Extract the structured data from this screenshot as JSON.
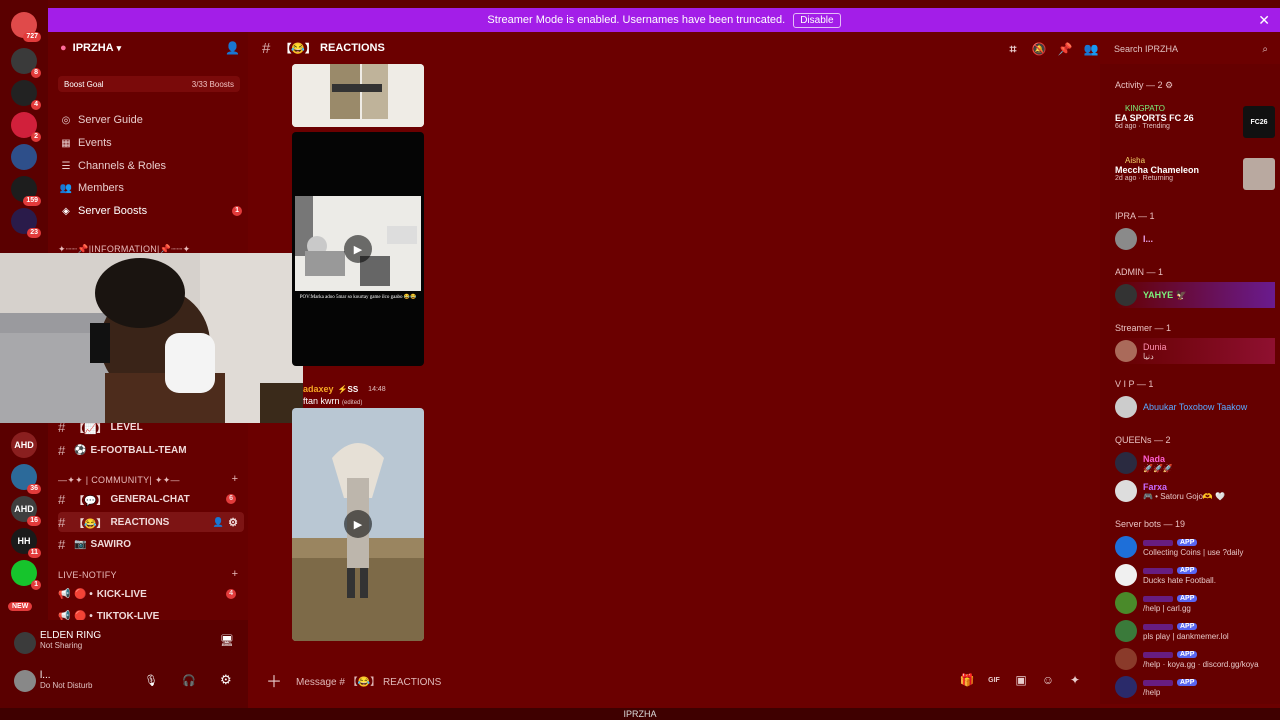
{
  "banner": {
    "text": "Streamer Mode is enabled. Usernames have been truncated.",
    "disable_label": "Disable"
  },
  "server": {
    "name": "IPRZHA",
    "boost_label": "Boost Goal",
    "boost_count": "3/33 Boosts"
  },
  "nav": [
    {
      "icon": "compass-icon",
      "label": "Server Guide"
    },
    {
      "icon": "calendar-icon",
      "label": "Events"
    },
    {
      "icon": "list-icon",
      "label": "Channels & Roles"
    },
    {
      "icon": "members-icon",
      "label": "Members"
    },
    {
      "icon": "boost-icon",
      "label": "Server Boosts",
      "badge": "1"
    }
  ],
  "categories": {
    "information": "✦┈┈📌|INFORMATION|📌┈┈✦",
    "community": "—✦✦ | COMMUNITY| ✦✦—",
    "live": "LIVE-NOTIFY"
  },
  "channels": [
    {
      "label": "LEVEL",
      "prefix": "【📈】"
    },
    {
      "label": "E-FOOTBALL-TEAM",
      "prefix": "⚽"
    },
    {
      "label": "GENERAL-CHAT",
      "prefix": "【💬】",
      "badge": "6"
    },
    {
      "label": "REACTIONS",
      "prefix": "【😂】"
    },
    {
      "label": "SAWIRO",
      "prefix": "📷"
    },
    {
      "label": "KICK-LIVE",
      "prefix": "🔴 •",
      "badge": "4"
    },
    {
      "label": "TIKTOK-LIVE",
      "prefix": "🔴 •"
    }
  ],
  "activity_card": {
    "title": "ELDEN RING",
    "subtitle": "Not Sharing"
  },
  "user": {
    "name": "l...",
    "status": "Do Not Disturb"
  },
  "channel": {
    "prefix": "【😂】",
    "name": "REACTIONS"
  },
  "search": {
    "placeholder": "Search IPRZHA"
  },
  "message": {
    "author": "adaxey",
    "tag": "⚡SS",
    "time": "14:48",
    "text": "ftan kwrn",
    "edited": "(edited)",
    "video_caption": "POV:Marka adoo 5mar so kourtay game ilco gaabo 😂😂"
  },
  "composer": {
    "placeholder": "Message # 【😂】 REACTIONS"
  },
  "activity": {
    "title": "Activity — 2",
    "items": [
      {
        "user": "KINGPATO",
        "game": "EA SPORTS FC 26",
        "meta": "6d ago",
        "tag": "Trending",
        "thumb": "FC26"
      },
      {
        "user": "Aisha",
        "game": "Meccha Chameleon",
        "meta": "2d ago",
        "tag": "Returning"
      }
    ]
  },
  "member_sections": [
    {
      "title": "IPRA — 1",
      "members": [
        {
          "name": "I...",
          "color": "#e8a0e8"
        }
      ]
    },
    {
      "title": "ADMIN — 1",
      "members": [
        {
          "name": "YAHYE 🦅",
          "color": "#7cf07c"
        }
      ]
    },
    {
      "title": "Streamer — 1",
      "members": [
        {
          "name": "Dunia",
          "sub": "دنيا",
          "color": "#ff8fb0"
        }
      ]
    },
    {
      "title": "V I P — 1",
      "members": [
        {
          "name": "Abuukar Toxobow Taakow",
          "color": "#59a8ff"
        }
      ]
    },
    {
      "title": "QUEENs — 2",
      "members": [
        {
          "name": "Nada",
          "sub": "🚀🚀🚀",
          "color": "#ff5fd2"
        },
        {
          "name": "Farxa",
          "sub": "🎮 • Satoru Gojo🫶 🤍",
          "color": "#c86bff"
        }
      ]
    }
  ],
  "bots": {
    "title": "Server bots — 19",
    "app_label": "APP",
    "items": [
      {
        "sub": "Collecting Coins | use ?daily"
      },
      {
        "sub": "Ducks hate Football."
      },
      {
        "sub": "/help | carl.gg"
      },
      {
        "sub": "pls play | dankmemer.lol"
      },
      {
        "sub": "/help · koya.gg · discord.gg/koya"
      },
      {
        "sub": "/help"
      }
    ]
  },
  "window": {
    "title": "IPRZHA"
  },
  "rail": [
    {
      "badge": "727",
      "color": "#e04a4a",
      "letter": ""
    },
    {
      "badge": "8",
      "color": "#3a3a3a",
      "letter": ""
    },
    {
      "badge": "4",
      "color": "#222",
      "letter": ""
    },
    {
      "badge": "2",
      "color": "#d1203b",
      "letter": ""
    },
    {
      "badge": "",
      "color": "#2e4f8a",
      "letter": ""
    },
    {
      "badge": "159",
      "color": "#1d1d1d",
      "letter": ""
    },
    {
      "badge": "23",
      "color": "#2a1b4a",
      "letter": ""
    },
    {
      "badge": "",
      "color": "#8a1f1f",
      "letter": "AHD"
    },
    {
      "badge": "36",
      "color": "#2c6a9a",
      "letter": ""
    },
    {
      "badge": "16",
      "color": "#3f3f3f",
      "letter": "AHD"
    },
    {
      "badge": "11",
      "color": "#1a1a1a",
      "letter": "HH"
    },
    {
      "badge": "1",
      "color": "#16c42c",
      "letter": ""
    }
  ],
  "rail_new": "NEW"
}
